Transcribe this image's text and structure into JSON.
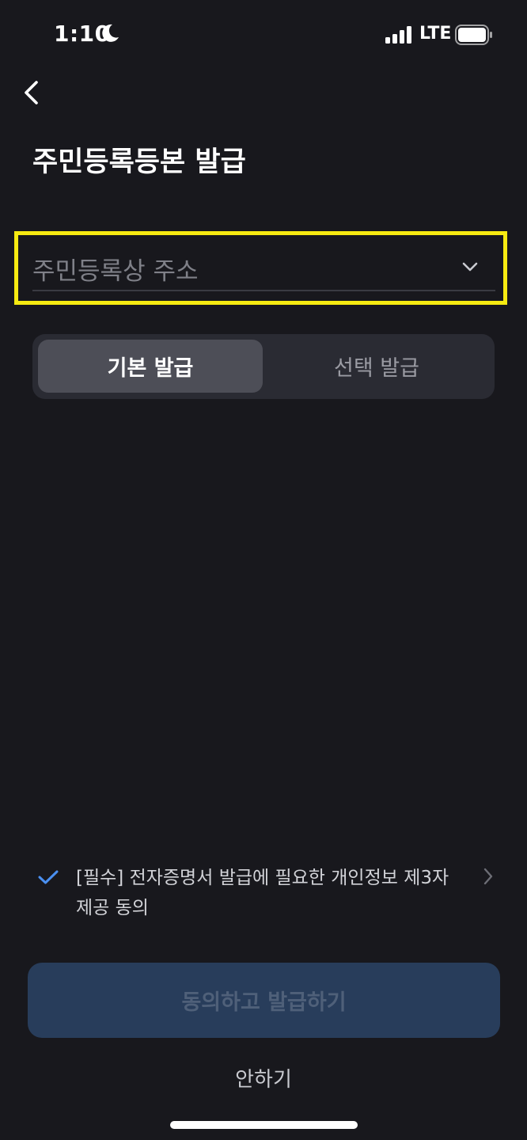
{
  "status_bar": {
    "time": "1:10",
    "network": "LTE",
    "icons": [
      "moon-icon",
      "signal-icon",
      "battery-icon"
    ]
  },
  "header": {
    "back_icon": "chevron-left-icon",
    "title": "주민등록등본 발급"
  },
  "address": {
    "placeholder": "주민등록상 주소",
    "dropdown_icon": "chevron-down-icon",
    "highlight_color": "#f6ea11"
  },
  "issue_type": {
    "options": [
      "기본 발급",
      "선택 발급"
    ],
    "selected": "기본 발급"
  },
  "consent": {
    "checked": true,
    "line1": "[필수] 전자증명서 발급에 필요한 개인정보 제3자",
    "line2": "제공 동의",
    "check_color": "#4a8ff0"
  },
  "actions": {
    "primary_label": "동의하고 발급하기",
    "secondary_label": "안하기"
  },
  "colors": {
    "background": "#18181d",
    "primary_button_bg": "#283d5b",
    "primary_button_text": "#4f6079"
  }
}
